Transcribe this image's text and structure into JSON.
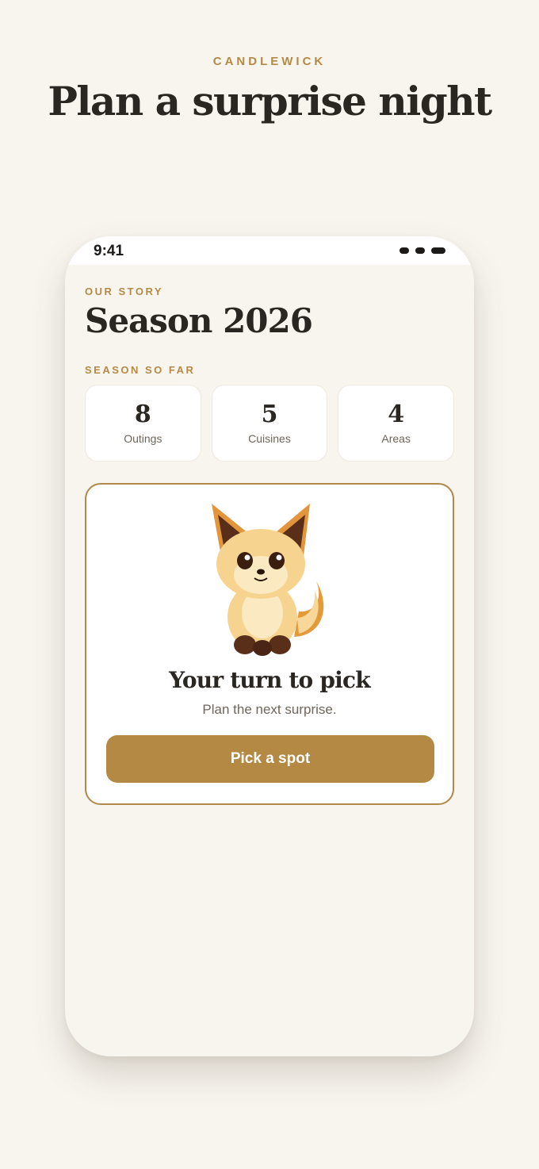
{
  "header": {
    "brand": "CANDLEWICK",
    "title": "Plan a surprise night"
  },
  "status_bar": {
    "time": "9:41"
  },
  "screen": {
    "eyebrow": "OUR STORY",
    "season_title": "Season 2026",
    "stats_label": "SEASON SO FAR",
    "stats": [
      {
        "value": "8",
        "label": "Outings"
      },
      {
        "value": "5",
        "label": "Cuisines"
      },
      {
        "value": "4",
        "label": "Areas"
      }
    ],
    "pick_card": {
      "mascot": "fox-mascot-illustration",
      "title": "Your turn to pick",
      "subtitle": "Plan the next surprise.",
      "button_label": "Pick a spot"
    }
  },
  "colors": {
    "background": "#f8f5ef",
    "accent": "#b48944",
    "text": "#2a2622",
    "muted": "#6e655b"
  }
}
